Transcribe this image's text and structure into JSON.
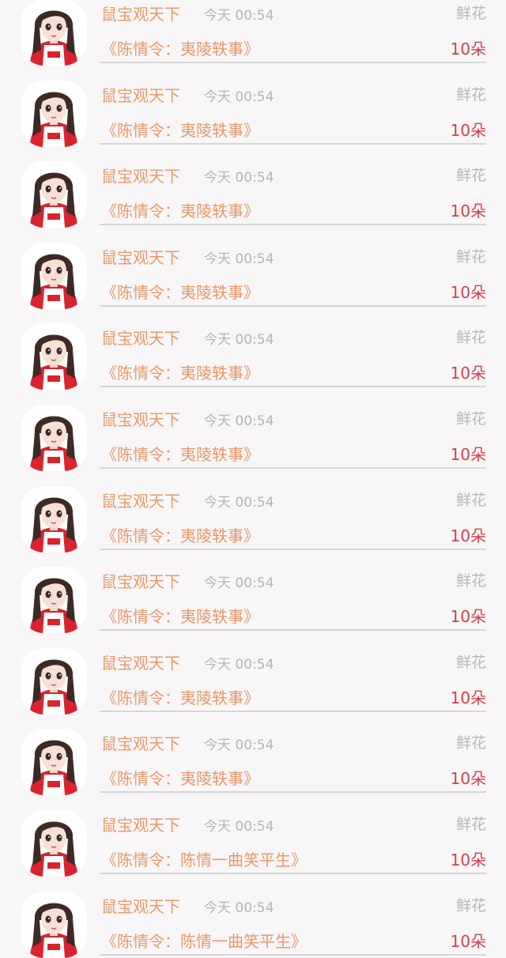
{
  "gift_list": [
    {
      "user": "鼠宝观天下",
      "time": "今天 00:54",
      "gift_type": "鲜花",
      "title": "《陈情令：夷陵轶事》",
      "count": "10朵"
    },
    {
      "user": "鼠宝观天下",
      "time": "今天 00:54",
      "gift_type": "鲜花",
      "title": "《陈情令：夷陵轶事》",
      "count": "10朵"
    },
    {
      "user": "鼠宝观天下",
      "time": "今天 00:54",
      "gift_type": "鲜花",
      "title": "《陈情令：夷陵轶事》",
      "count": "10朵"
    },
    {
      "user": "鼠宝观天下",
      "time": "今天 00:54",
      "gift_type": "鲜花",
      "title": "《陈情令：夷陵轶事》",
      "count": "10朵"
    },
    {
      "user": "鼠宝观天下",
      "time": "今天 00:54",
      "gift_type": "鲜花",
      "title": "《陈情令：夷陵轶事》",
      "count": "10朵"
    },
    {
      "user": "鼠宝观天下",
      "time": "今天 00:54",
      "gift_type": "鲜花",
      "title": "《陈情令：夷陵轶事》",
      "count": "10朵"
    },
    {
      "user": "鼠宝观天下",
      "time": "今天 00:54",
      "gift_type": "鲜花",
      "title": "《陈情令：夷陵轶事》",
      "count": "10朵"
    },
    {
      "user": "鼠宝观天下",
      "time": "今天 00:54",
      "gift_type": "鲜花",
      "title": "《陈情令：夷陵轶事》",
      "count": "10朵"
    },
    {
      "user": "鼠宝观天下",
      "time": "今天 00:54",
      "gift_type": "鲜花",
      "title": "《陈情令：夷陵轶事》",
      "count": "10朵"
    },
    {
      "user": "鼠宝观天下",
      "time": "今天 00:54",
      "gift_type": "鲜花",
      "title": "《陈情令：夷陵轶事》",
      "count": "10朵"
    },
    {
      "user": "鼠宝观天下",
      "time": "今天 00:54",
      "gift_type": "鲜花",
      "title": "《陈情令：陈情一曲笑平生》",
      "count": "10朵"
    },
    {
      "user": "鼠宝观天下",
      "time": "今天 00:54",
      "gift_type": "鲜花",
      "title": "《陈情令：陈情一曲笑平生》",
      "count": "10朵"
    }
  ],
  "colors": {
    "background": "#f8f6f7",
    "name": "#e8986a",
    "muted": "#b5b5b5",
    "count": "#d2404a",
    "divider": "#d6d6d6"
  },
  "avatar_icon": "cartoon-girl-avatar-icon"
}
